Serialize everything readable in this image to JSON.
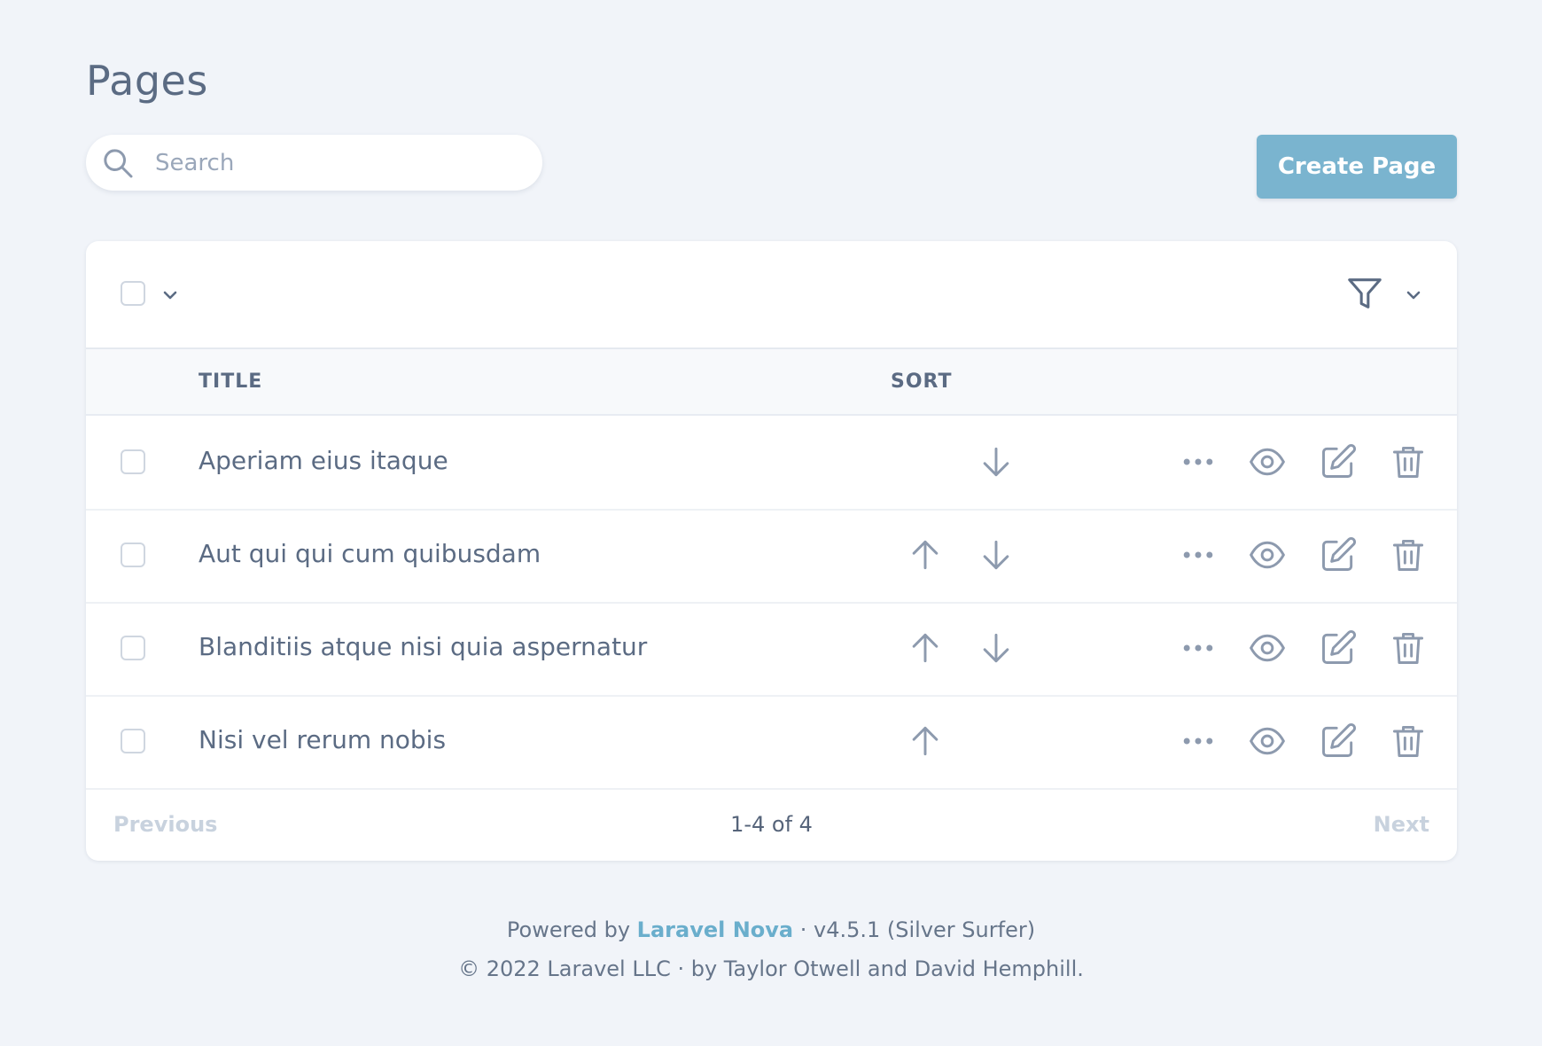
{
  "page": {
    "title": "Pages"
  },
  "search": {
    "placeholder": "Search"
  },
  "create_button": {
    "label": "Create Page"
  },
  "table": {
    "columns": {
      "title": "TITLE",
      "sort": "SORT"
    },
    "rows": [
      {
        "title": "Aperiam eius itaque",
        "can_move_up": false,
        "can_move_down": true
      },
      {
        "title": "Aut qui qui cum quibusdam",
        "can_move_up": true,
        "can_move_down": true
      },
      {
        "title": "Blanditiis atque nisi quia aspernatur",
        "can_move_up": true,
        "can_move_down": true
      },
      {
        "title": "Nisi vel rerum nobis",
        "can_move_up": true,
        "can_move_down": false
      }
    ]
  },
  "pagination": {
    "previous": "Previous",
    "info": "1-4 of 4",
    "next": "Next"
  },
  "footer": {
    "powered_prefix": "Powered by",
    "brand": "Laravel Nova",
    "version": "· v4.5.1 (Silver Surfer)",
    "copyright": "© 2022 Laravel LLC · by Taylor Otwell and David Hemphill."
  },
  "colors": {
    "background": "#f1f4f9",
    "accent": "#7ab4cf",
    "link": "#6aaecc",
    "icon": "#8d9aae",
    "text": "#5b6b83"
  },
  "icons": {
    "search": "search-icon",
    "filter": "filter-icon",
    "chevron": "chevron-down-icon",
    "move_up": "arrow-up-icon",
    "move_down": "arrow-down-icon",
    "more": "more-dots-icon",
    "view": "eye-icon",
    "edit": "edit-icon",
    "delete": "trash-icon"
  }
}
